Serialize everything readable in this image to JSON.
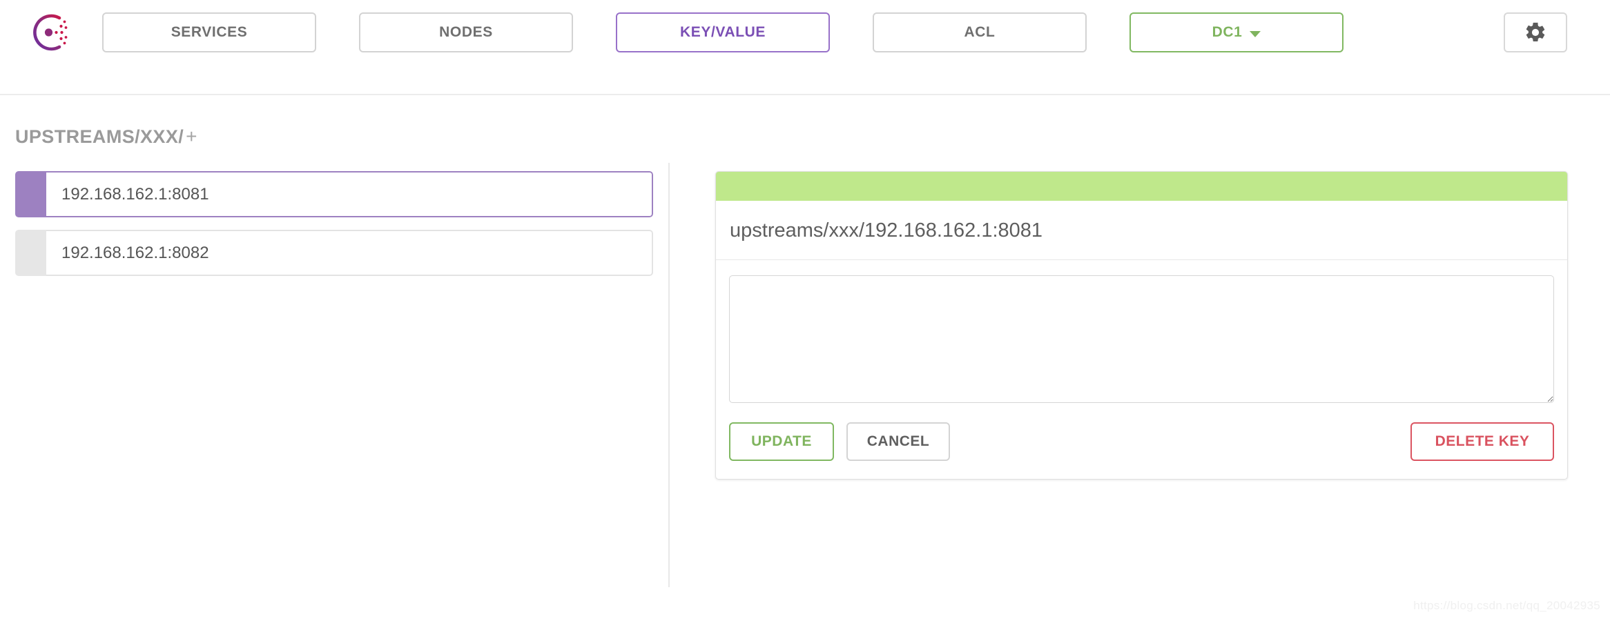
{
  "header": {
    "logo_name": "consul-logo",
    "nav": [
      {
        "id": "services",
        "label": "SERVICES",
        "active": false
      },
      {
        "id": "nodes",
        "label": "NODES",
        "active": false
      },
      {
        "id": "key-value",
        "label": "KEY/VALUE",
        "active": true
      },
      {
        "id": "acl",
        "label": "ACL",
        "active": false
      }
    ],
    "datacenter": {
      "label": "DC1",
      "icon": "chevron-down-icon"
    },
    "settings": {
      "icon": "gear-icon",
      "label": ""
    }
  },
  "breadcrumb": {
    "path": "UPSTREAMS/XXX/",
    "add": "+"
  },
  "kv_list": {
    "items": [
      {
        "label": "192.168.162.1:8081",
        "selected": true
      },
      {
        "label": "192.168.162.1:8082",
        "selected": false
      }
    ]
  },
  "detail": {
    "key": "upstreams/xxx/192.168.162.1:8081",
    "value": "",
    "value_placeholder": "",
    "buttons": {
      "update": "UPDATE",
      "cancel": "CANCEL",
      "delete": "DELETE KEY"
    }
  },
  "watermark": "https://blog.csdn.net/qq_20042935",
  "colors": {
    "accent_purple": "#7b4fb5",
    "selected_bar": "#9d81c1",
    "accent_green": "#7fb45e",
    "panel_accent": "#bfe88b",
    "danger_red": "#d9525f",
    "text_gray": "#5e5e5e",
    "border_gray": "#d3d3d3"
  }
}
